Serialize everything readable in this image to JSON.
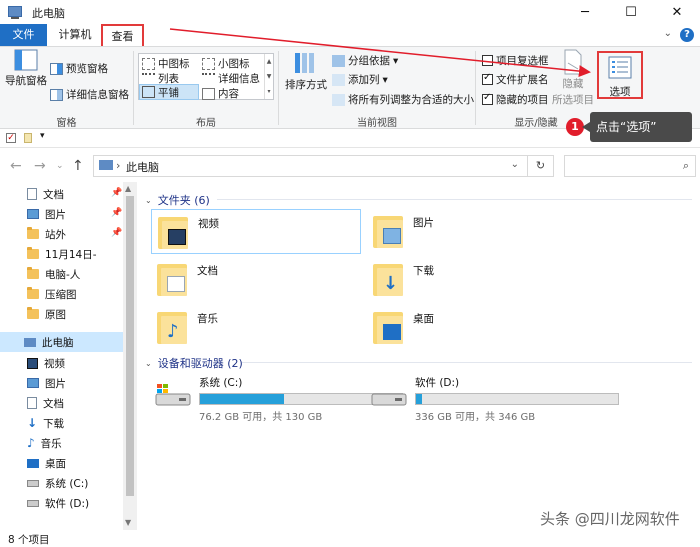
{
  "window": {
    "title": "此电脑",
    "controls": [
      "minimize-icon",
      "maximize-icon",
      "close-icon"
    ]
  },
  "ribbon_tabs": {
    "file": "文件",
    "computer": "计算机",
    "view": "查看",
    "view_highlighted": true
  },
  "ribbon": {
    "panes": {
      "navigation_pane": "导航窗格",
      "preview_pane": "预览窗格",
      "details_pane": "详细信息窗格",
      "group_label": "窗格"
    },
    "layout": {
      "options": [
        "中图标",
        "小图标",
        "列表",
        "详细信息",
        "平铺",
        "内容"
      ],
      "selected": "平铺",
      "group_label": "布局"
    },
    "current_view": {
      "sort_by": "排序方式",
      "group_by": "分组依据",
      "add_column": "添加列",
      "size_all_columns": "将所有列调整为合适的大小",
      "group_label": "当前视图"
    },
    "show_hide": {
      "item_check_boxes": {
        "label": "项目复选框",
        "checked": false
      },
      "file_extensions": {
        "label": "文件扩展名",
        "checked": true
      },
      "hidden_items": {
        "label": "隐藏的项目",
        "checked": true
      },
      "hide_selected": "隐藏",
      "hide_selected_sub": "所选项目",
      "group_label": "显示/隐藏"
    },
    "options": {
      "label": "选项",
      "highlighted": true
    }
  },
  "annotation": {
    "step": "1",
    "text": "点击“选项”"
  },
  "address_bar": {
    "path": "此电脑",
    "sep": "›"
  },
  "nav_pane": {
    "quick_access": [
      {
        "label": "文档",
        "icon": "documents-icon",
        "pinned": true
      },
      {
        "label": "图片",
        "icon": "pictures-icon",
        "pinned": true
      },
      {
        "label": "站外",
        "icon": "folder-icon",
        "pinned": true
      },
      {
        "label": "11月14日-",
        "icon": "folder-icon",
        "pinned": false
      },
      {
        "label": "电脑-人",
        "icon": "folder-icon",
        "pinned": false
      },
      {
        "label": "压缩图",
        "icon": "folder-icon",
        "pinned": false
      },
      {
        "label": "原图",
        "icon": "folder-icon",
        "pinned": false
      }
    ],
    "this_pc": "此电脑",
    "this_pc_children": [
      {
        "label": "视频",
        "icon": "videos-icon"
      },
      {
        "label": "图片",
        "icon": "pictures-icon"
      },
      {
        "label": "文档",
        "icon": "documents-icon"
      },
      {
        "label": "下载",
        "icon": "downloads-icon"
      },
      {
        "label": "音乐",
        "icon": "music-icon"
      },
      {
        "label": "桌面",
        "icon": "desktop-icon"
      },
      {
        "label": "系统 (C:)",
        "icon": "system-drive-icon"
      },
      {
        "label": "软件 (D:)",
        "icon": "drive-icon"
      }
    ]
  },
  "main": {
    "folders_header": "文件夹 (6)",
    "folders": [
      {
        "label": "视频",
        "icon": "videos-folder-icon"
      },
      {
        "label": "图片",
        "icon": "pictures-folder-icon"
      },
      {
        "label": "文档",
        "icon": "documents-folder-icon"
      },
      {
        "label": "下载",
        "icon": "downloads-folder-icon"
      },
      {
        "label": "音乐",
        "icon": "music-folder-icon"
      },
      {
        "label": "桌面",
        "icon": "desktop-folder-icon"
      }
    ],
    "drives_header": "设备和驱动器 (2)",
    "drives": [
      {
        "label": "系统 (C:)",
        "free": "76.2 GB 可用，共 130 GB",
        "used_fraction": 0.414
      },
      {
        "label": "软件 (D:)",
        "free": "336 GB 可用，共 346 GB",
        "used_fraction": 0.029
      }
    ]
  },
  "status_bar": {
    "item_count": "8 个项目"
  },
  "watermark": "头条 @四川龙网软件",
  "colors": {
    "accent": "#1f6fc5",
    "highlight_red": "#e23a3a",
    "selection": "#cce8ff",
    "drive_fill": "#26a0da"
  }
}
